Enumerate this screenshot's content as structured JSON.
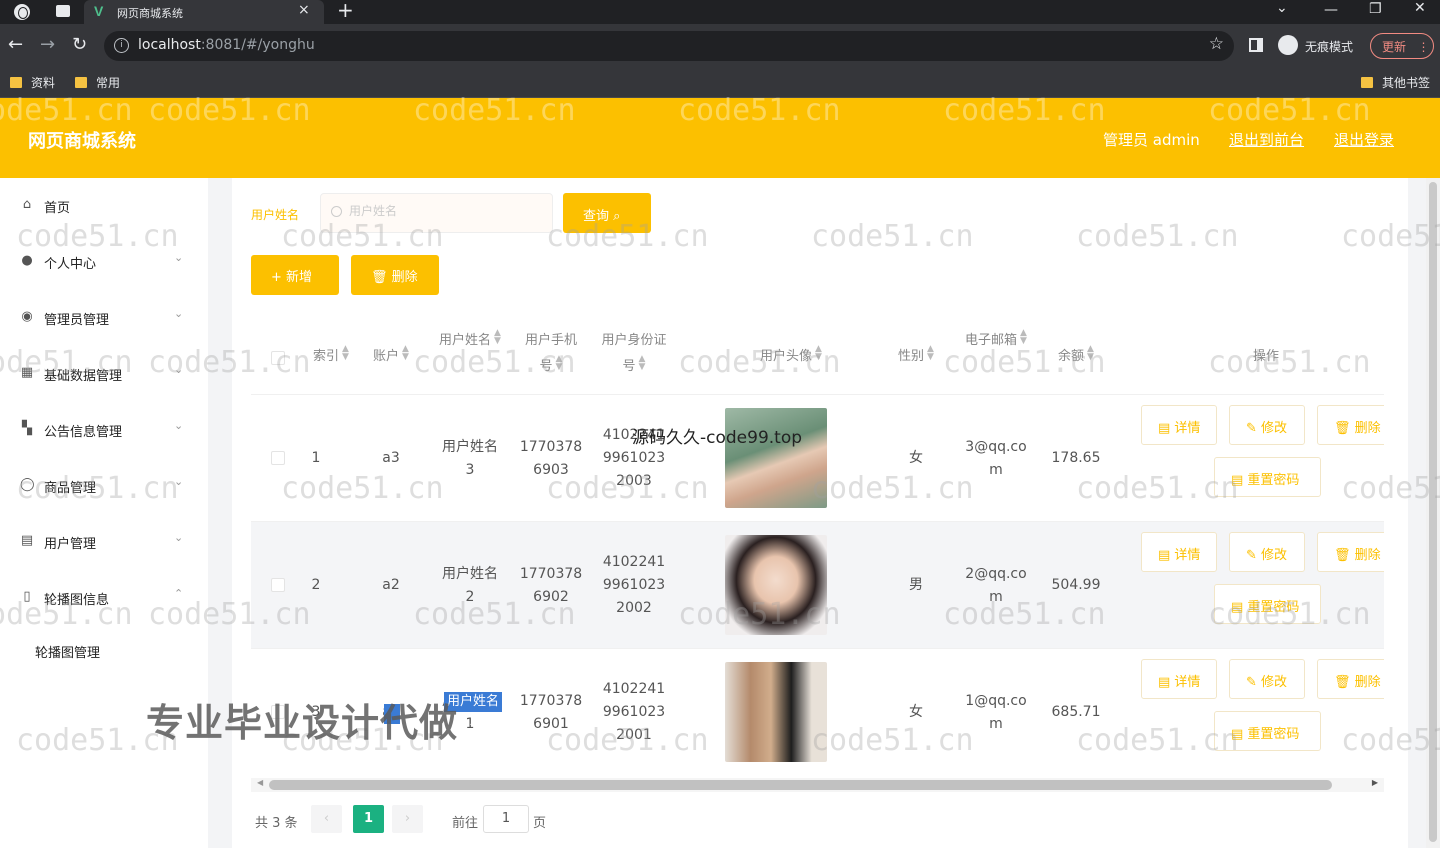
{
  "browser": {
    "tab_title": "网页商城系统",
    "url_host": "localhost",
    "url_rest": ":8081/#/yonghu",
    "incognito_label": "无痕模式",
    "update_label": "更新",
    "bookmarks": [
      "资料",
      "常用"
    ],
    "other_bookmarks": "其他书签"
  },
  "header": {
    "title": "网页商城系统",
    "admin_label": "管理员 admin",
    "back_front": "退出到前台",
    "logout": "退出登录"
  },
  "sidebar": {
    "items": [
      {
        "label": "首页",
        "icon": "home-icon",
        "arrow": ""
      },
      {
        "label": "个人中心",
        "icon": "user-icon",
        "arrow": "⌄"
      },
      {
        "label": "管理员管理",
        "icon": "admin-icon",
        "arrow": "⌄"
      },
      {
        "label": "基础数据管理",
        "icon": "grid-icon",
        "arrow": "⌄"
      },
      {
        "label": "公告信息管理",
        "icon": "tiles-icon",
        "arrow": "⌄"
      },
      {
        "label": "商品管理",
        "icon": "circle-icon",
        "arrow": "⌄"
      },
      {
        "label": "用户管理",
        "icon": "doc-icon",
        "arrow": "⌄"
      },
      {
        "label": "轮播图信息",
        "icon": "mobile-icon",
        "arrow": "⌃"
      }
    ],
    "submenu": "轮播图管理"
  },
  "search": {
    "label": "用户姓名",
    "placeholder": "用户姓名",
    "query_btn": "查询",
    "add_btn": "+ 新增",
    "delete_btn": "删除"
  },
  "table": {
    "headers": {
      "index": "索引",
      "account": "账户",
      "name": "用户姓名",
      "phone": "用户手机号",
      "idcard": "用户身份证号",
      "avatar": "用户头像",
      "gender": "性别",
      "email": "电子邮箱",
      "balance": "余额",
      "ops": "操作"
    },
    "rows": [
      {
        "index": "1",
        "account": "a3",
        "name": "用户姓名3",
        "phone": "17703786903",
        "idcard": "410224199610232003",
        "gender": "女",
        "email": "3@qq.com",
        "balance": "178.65"
      },
      {
        "index": "2",
        "account": "a2",
        "name": "用户姓名2",
        "phone": "17703786902",
        "idcard": "410224199610232002",
        "gender": "男",
        "email": "2@qq.com",
        "balance": "504.99"
      },
      {
        "index": "3",
        "account": "a1",
        "name": "用户姓名1",
        "phone": "17703786901",
        "idcard": "410224199610232001",
        "gender": "女",
        "email": "1@qq.com",
        "balance": "685.71"
      }
    ],
    "ops": {
      "detail": "详情",
      "edit": "修改",
      "delete": "删除",
      "reset": "重置密码"
    }
  },
  "pager": {
    "total": "共 3 条",
    "current_page": "1",
    "goto_label": "前往",
    "goto_value": "1",
    "unit": "页"
  },
  "overlays": {
    "watermark": "code51.cn",
    "source": "源码久久-code99.top",
    "promo": "专业毕业设计代做"
  },
  "colors": {
    "accent": "#fcc000",
    "pager_active": "#1bb181"
  }
}
